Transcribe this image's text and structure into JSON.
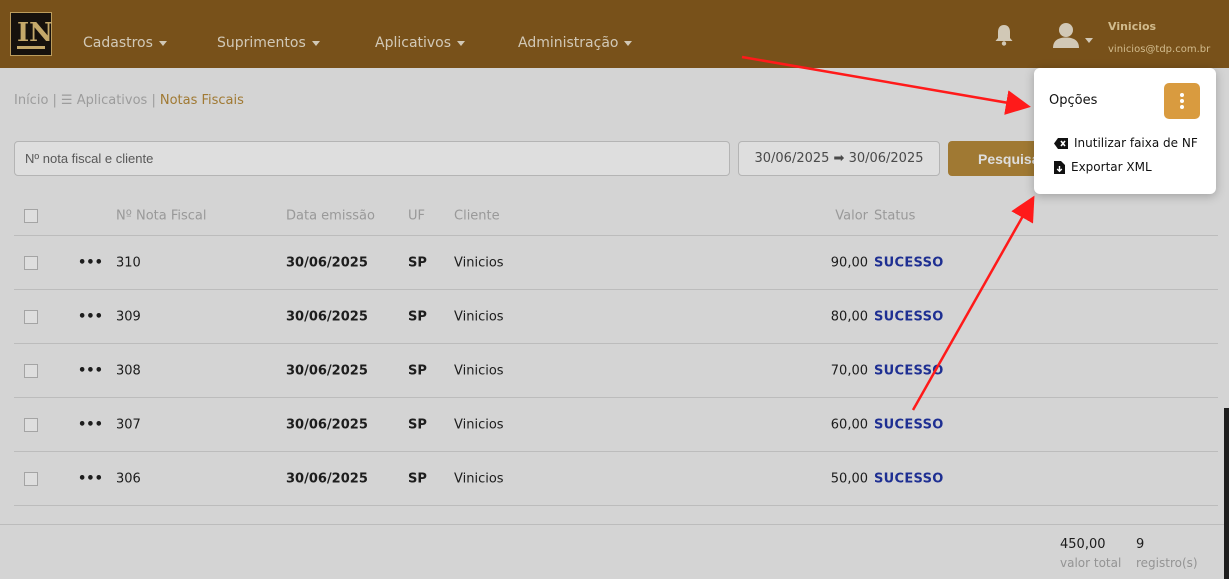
{
  "nav": {
    "items": [
      {
        "label": "Cadastros"
      },
      {
        "label": "Suprimentos"
      },
      {
        "label": "Aplicativos"
      },
      {
        "label": "Administração"
      }
    ],
    "user": {
      "name": "Vinicios",
      "email": "vinicios@tdp.com.br"
    },
    "logo_text": "IN"
  },
  "breadcrumb": {
    "home": "Início |",
    "apps": "☰ Aplicativos |",
    "current": "Notas Fiscais"
  },
  "filters": {
    "search_placeholder": "Nº nota fiscal e cliente",
    "date_range": "30/06/2025 ➡ 30/06/2025",
    "search_label": "Pesquisar"
  },
  "table": {
    "headers": {
      "number": "Nº Nota Fiscal",
      "date": "Data emissão",
      "uf": "UF",
      "client": "Cliente",
      "value": "Valor",
      "status": "Status"
    },
    "rows": [
      {
        "number": "310",
        "date": "30/06/2025",
        "uf": "SP",
        "client": "Vinicios",
        "value": "90,00",
        "status": "SUCESSO"
      },
      {
        "number": "309",
        "date": "30/06/2025",
        "uf": "SP",
        "client": "Vinicios",
        "value": "80,00",
        "status": "SUCESSO"
      },
      {
        "number": "308",
        "date": "30/06/2025",
        "uf": "SP",
        "client": "Vinicios",
        "value": "70,00",
        "status": "SUCESSO"
      },
      {
        "number": "307",
        "date": "30/06/2025",
        "uf": "SP",
        "client": "Vinicios",
        "value": "60,00",
        "status": "SUCESSO"
      },
      {
        "number": "306",
        "date": "30/06/2025",
        "uf": "SP",
        "client": "Vinicios",
        "value": "50,00",
        "status": "SUCESSO"
      }
    ],
    "row_menu_glyph": "•••"
  },
  "footer": {
    "total_value": "450,00",
    "total_label": "valor total",
    "count_value": "9",
    "count_label": "registro(s)"
  },
  "dropdown": {
    "title": "Opções",
    "items": [
      {
        "label": "Inutilizar faixa de NF"
      },
      {
        "label": "Exportar XML"
      }
    ]
  },
  "colors": {
    "topbar": "#8a5e1e",
    "accent": "#b88c3b",
    "kebab": "#d99b3f",
    "status": "#2336a8",
    "arrow": "#ff1a1a"
  }
}
